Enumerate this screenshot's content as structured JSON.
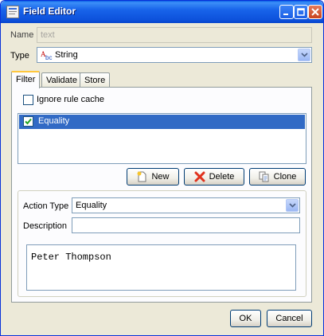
{
  "window": {
    "title": "Field Editor"
  },
  "name": {
    "label": "Name",
    "value": "text"
  },
  "type": {
    "label": "Type",
    "value": "String"
  },
  "tabs": [
    {
      "label": "Filter",
      "active": true
    },
    {
      "label": "Validate",
      "active": false
    },
    {
      "label": "Store",
      "active": false
    }
  ],
  "filter": {
    "ignore_cache_label": "Ignore rule cache",
    "ignore_cache_checked": false,
    "rules": [
      {
        "label": "Equality",
        "checked": true,
        "selected": true
      }
    ],
    "buttons": {
      "new": "New",
      "delete": "Delete",
      "clone": "Clone"
    },
    "action_type_label": "Action Type",
    "action_type_value": "Equality",
    "description_label": "Description",
    "description_value": "",
    "body_text": "Peter Thompson"
  },
  "footer": {
    "ok": "OK",
    "cancel": "Cancel"
  },
  "colors": {
    "title_bar": "#0c50da",
    "selection": "#316ac5",
    "window_bg": "#ece9d8"
  }
}
